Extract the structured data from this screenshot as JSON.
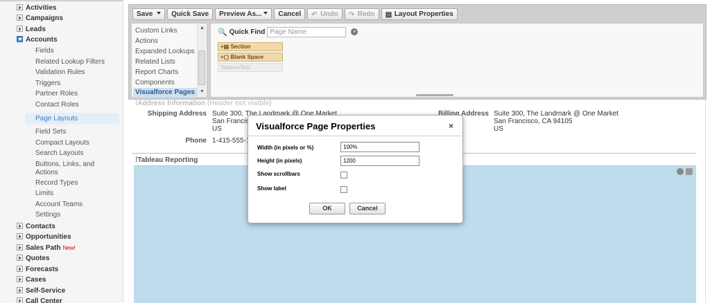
{
  "sidebar": {
    "items": [
      {
        "label": "Activities"
      },
      {
        "label": "Campaigns"
      },
      {
        "label": "Leads"
      },
      {
        "label": "Accounts"
      }
    ],
    "accounts_children": [
      {
        "label": "Fields"
      },
      {
        "label": "Related Lookup Filters"
      },
      {
        "label": "Validation Rules"
      },
      {
        "label": "Triggers"
      },
      {
        "label": "Partner Roles"
      },
      {
        "label": "Contact Roles"
      },
      {
        "label": "Page Layouts"
      },
      {
        "label": "Field Sets"
      },
      {
        "label": "Compact Layouts"
      },
      {
        "label": "Search Layouts"
      },
      {
        "label": "Buttons, Links, and"
      },
      {
        "label": "Actions"
      },
      {
        "label": "Record Types"
      },
      {
        "label": "Limits"
      },
      {
        "label": "Account Teams"
      },
      {
        "label": "Settings"
      }
    ],
    "items_after": [
      {
        "label": "Contacts"
      },
      {
        "label": "Opportunities"
      },
      {
        "label": "Sales Path",
        "badge": "New!"
      },
      {
        "label": "Quotes"
      },
      {
        "label": "Forecasts"
      },
      {
        "label": "Cases"
      },
      {
        "label": "Self-Service"
      },
      {
        "label": "Call Center"
      }
    ]
  },
  "toolbar": {
    "save": "Save",
    "quick_save": "Quick Save",
    "preview_as": "Preview As...",
    "cancel": "Cancel",
    "undo": "Undo",
    "redo": "Redo",
    "layout_properties": "Layout Properties"
  },
  "palette": {
    "categories": [
      {
        "label": "Custom Links"
      },
      {
        "label": "Actions"
      },
      {
        "label": "Expanded Lookups"
      },
      {
        "label": "Related Lists"
      },
      {
        "label": "Report Charts"
      },
      {
        "label": "Components"
      },
      {
        "label": "Visualforce Pages"
      }
    ],
    "quick_find_label": "Quick Find",
    "quick_find_placeholder": "Page Name",
    "items": [
      {
        "label": "Section"
      },
      {
        "label": "Blank Space"
      },
      {
        "label": "TableauTest"
      }
    ]
  },
  "layout": {
    "address_section": "Address Information",
    "address_section_note": "(Header not visible)",
    "shipping_label": "Shipping Address",
    "shipping_line1": "Suite 300, The Landmark @ One Market",
    "shipping_line2": "San Francisc",
    "shipping_line3": "US",
    "billing_label": "Billing Address",
    "billing_line1": "Suite 300, The Landmark @ One Market",
    "billing_line2": "San Francisco, CA 94105",
    "billing_line3": "US",
    "phone_label": "Phone",
    "phone_value": "1-415-555-1",
    "tableau_section": "Tableau Reporting"
  },
  "modal": {
    "title": "Visualforce Page Properties",
    "close": "×",
    "width_label": "Width (in pixels or %)",
    "width_value": "100%",
    "height_label": "Height (in pixels)",
    "height_value": "1200",
    "scrollbars_label": "Show scrollbars",
    "show_label_label": "Show label",
    "ok": "OK",
    "cancel": "Cancel"
  }
}
